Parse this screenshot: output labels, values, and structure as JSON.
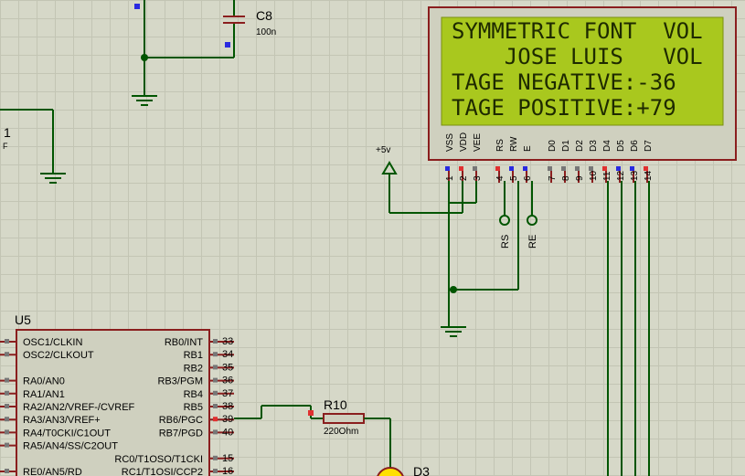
{
  "capacitor": {
    "ref": "C8",
    "value": "100n"
  },
  "left_fragment": {
    "ref": "1",
    "text": "F"
  },
  "power": {
    "label": "+5v"
  },
  "lcd": {
    "lines": [
      "SYMMETRIC FONT  VOL",
      "    JOSE LUIS   VOL",
      "TAGE NEGATIVE:-36",
      "TAGE POSITIVE:+79"
    ],
    "pins": [
      {
        "name": "VSS",
        "num": "1"
      },
      {
        "name": "VDD",
        "num": "2"
      },
      {
        "name": "VEE",
        "num": "3"
      },
      {
        "name": "RS",
        "num": "4"
      },
      {
        "name": "RW",
        "num": "5"
      },
      {
        "name": "E",
        "num": "6"
      },
      {
        "name": "D0",
        "num": "7"
      },
      {
        "name": "D1",
        "num": "8"
      },
      {
        "name": "D2",
        "num": "9"
      },
      {
        "name": "D3",
        "num": "10"
      },
      {
        "name": "D4",
        "num": "11"
      },
      {
        "name": "D5",
        "num": "12"
      },
      {
        "name": "D6",
        "num": "13"
      },
      {
        "name": "D7",
        "num": "14"
      }
    ],
    "screen_color": "#a9c81e",
    "frame_color": "#8a1e1e"
  },
  "terminals": {
    "rs": "RS",
    "re": "RE"
  },
  "mcu": {
    "ref": "U5",
    "left_pins": [
      "OSC1/CLKIN",
      "OSC2/CLKOUT",
      "",
      "RA0/AN0",
      "RA1/AN1",
      "RA2/AN2/VREF-/CVREF",
      "RA3/AN3/VREF+",
      "RA4/T0CKI/C1OUT",
      "RA5/AN4/SS/C2OUT",
      "",
      "RE0/AN5/RD"
    ],
    "right_pins": [
      {
        "name": "RB0/INT",
        "num": "33"
      },
      {
        "name": "RB1",
        "num": "34"
      },
      {
        "name": "RB2",
        "num": "35"
      },
      {
        "name": "RB3/PGM",
        "num": "36"
      },
      {
        "name": "RB4",
        "num": "37"
      },
      {
        "name": "RB5",
        "num": "38"
      },
      {
        "name": "RB6/PGC",
        "num": "39"
      },
      {
        "name": "RB7/PGD",
        "num": "40"
      },
      {
        "name": "",
        "num": ""
      },
      {
        "name": "RC0/T1OSO/T1CKI",
        "num": "15"
      },
      {
        "name": "RC1/T1OSI/CCP2",
        "num": "16"
      }
    ]
  },
  "resistor": {
    "ref": "R10",
    "value": "220Ohm"
  },
  "diode": {
    "ref": "D3"
  }
}
